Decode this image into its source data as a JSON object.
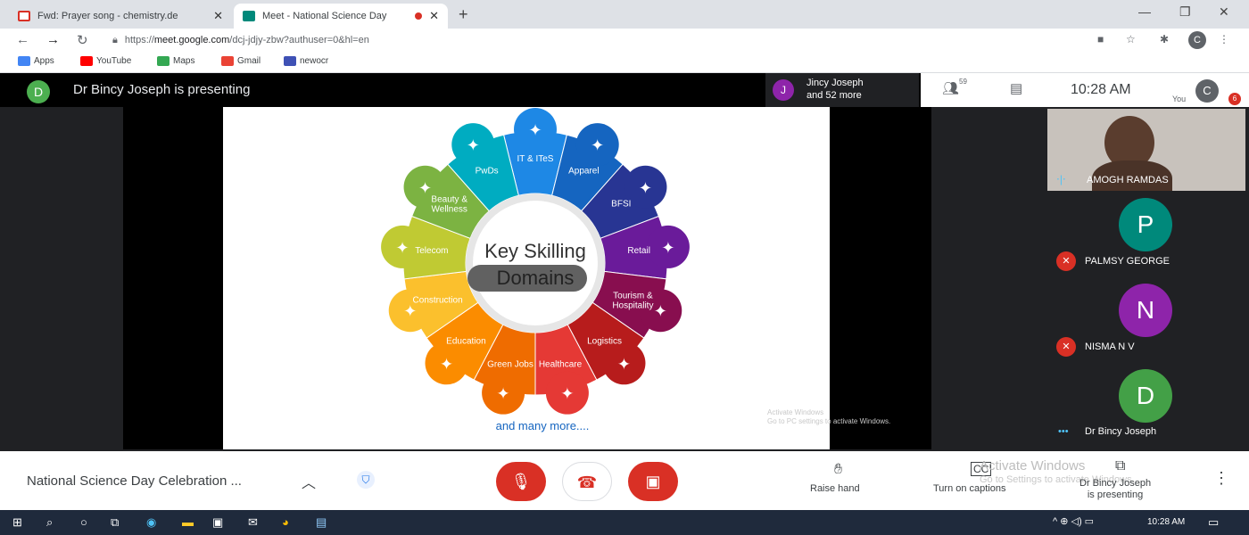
{
  "browser": {
    "tabs": [
      {
        "title": "Fwd: Prayer song - chemistry.de",
        "active": false,
        "favicon_color": "#d93025"
      },
      {
        "title": "Meet - National Science Day",
        "active": true,
        "favicon_color": "#00897b"
      }
    ],
    "url_prefix": "https://",
    "url_host": "meet.google.com",
    "url_path": "/dcj-jdjy-zbw?authuser=0&hl=en",
    "profile_initial": "C",
    "bookmarks": [
      {
        "label": "Apps",
        "color": "#4285f4"
      },
      {
        "label": "YouTube",
        "color": "#ff0000"
      },
      {
        "label": "Maps",
        "color": "#34a853"
      },
      {
        "label": "Gmail",
        "color": "#ea4335"
      },
      {
        "label": "newocr",
        "color": "#3f51b5"
      }
    ]
  },
  "meet": {
    "presenter_initial": "D",
    "presenter_text": "Dr Bincy Joseph is presenting",
    "jincy": {
      "initial": "J",
      "line1": "Jincy Joseph",
      "line2": "and 52 more"
    },
    "people_count": "59",
    "time": "10:28 AM",
    "you_label": "You",
    "you_initial": "C",
    "badge": "6"
  },
  "slide": {
    "title_line1": "Key Skilling",
    "title_line2": "Domains",
    "footer": "and many more....",
    "watermark_line1": "Activate Windows",
    "watermark_line2": "Go to PC settings to activate Windows.",
    "segments": [
      {
        "label": "IT & ITeS",
        "color": "#1e88e5"
      },
      {
        "label": "Apparel",
        "color": "#1565c0"
      },
      {
        "label": "BFSI",
        "color": "#283593"
      },
      {
        "label": "Retail",
        "color": "#6a1b9a"
      },
      {
        "label": "Tourism & Hospitality",
        "color": "#880e4f"
      },
      {
        "label": "Logistics",
        "color": "#b71c1c"
      },
      {
        "label": "Healthcare",
        "color": "#e53935"
      },
      {
        "label": "Green Jobs",
        "color": "#ef6c00"
      },
      {
        "label": "Education",
        "color": "#fb8c00"
      },
      {
        "label": "Construction",
        "color": "#fbc02d"
      },
      {
        "label": "Telecom",
        "color": "#c0ca33"
      },
      {
        "label": "Beauty & Wellness",
        "color": "#7cb342"
      },
      {
        "label": "PwDs",
        "color": "#00acc1"
      }
    ]
  },
  "participants": [
    {
      "name": "AMOGH RAMDAS",
      "initial": "",
      "color": ""
    },
    {
      "name": "PALMSY GEORGE",
      "initial": "P",
      "color": "#00897b"
    },
    {
      "name": "NISMA N V",
      "initial": "N",
      "color": "#8e24aa"
    },
    {
      "name": "Dr Bincy Joseph",
      "initial": "D",
      "color": "#43a047"
    }
  ],
  "controls": {
    "meeting_title": "National Science Day Celebration ...",
    "raise_hand": "Raise hand",
    "captions": "Turn on captions",
    "presenting_line1": "Dr Bincy Joseph",
    "presenting_line2": "is presenting",
    "activate_big": "Activate Windows",
    "activate_sub": "Go to Settings to activate Windows."
  },
  "taskbar": {
    "time": "10:28 AM"
  }
}
